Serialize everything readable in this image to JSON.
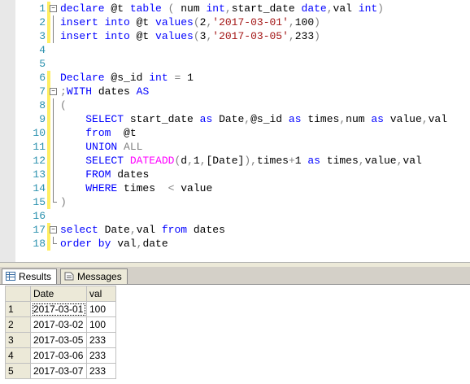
{
  "editor": {
    "lines": [
      {
        "n": "1",
        "segments": [
          [
            "kw",
            "declare "
          ],
          [
            "blk",
            "@t "
          ],
          [
            "kw",
            "table "
          ],
          [
            "gray",
            "( "
          ],
          [
            "blk",
            "num "
          ],
          [
            "kw",
            "int"
          ],
          [
            "gray",
            ","
          ],
          [
            "blk",
            "start_date "
          ],
          [
            "kw",
            "date"
          ],
          [
            "gray",
            ","
          ],
          [
            "blk",
            "val "
          ],
          [
            "kw",
            "int"
          ],
          [
            "gray",
            ")"
          ]
        ]
      },
      {
        "n": "2",
        "segments": [
          [
            "kw",
            "insert into "
          ],
          [
            "blk",
            "@t "
          ],
          [
            "kw",
            "values"
          ],
          [
            "gray",
            "("
          ],
          [
            "blk",
            "2"
          ],
          [
            "gray",
            ","
          ],
          [
            "str",
            "'2017-03-01'"
          ],
          [
            "gray",
            ","
          ],
          [
            "blk",
            "100"
          ],
          [
            "gray",
            ")"
          ]
        ]
      },
      {
        "n": "3",
        "segments": [
          [
            "kw",
            "insert into "
          ],
          [
            "blk",
            "@t "
          ],
          [
            "kw",
            "values"
          ],
          [
            "gray",
            "("
          ],
          [
            "blk",
            "3"
          ],
          [
            "gray",
            ","
          ],
          [
            "str",
            "'2017-03-05'"
          ],
          [
            "gray",
            ","
          ],
          [
            "blk",
            "233"
          ],
          [
            "gray",
            ")"
          ]
        ]
      },
      {
        "n": "4",
        "segments": []
      },
      {
        "n": "5",
        "segments": []
      },
      {
        "n": "6",
        "segments": [
          [
            "kw",
            "Declare "
          ],
          [
            "blk",
            "@s_id "
          ],
          [
            "kw",
            "int "
          ],
          [
            "gray",
            "= "
          ],
          [
            "blk",
            "1"
          ]
        ]
      },
      {
        "n": "7",
        "segments": [
          [
            "gray",
            ";"
          ],
          [
            "kw",
            "WITH "
          ],
          [
            "blk",
            "dates "
          ],
          [
            "kw",
            "AS"
          ]
        ]
      },
      {
        "n": "8",
        "segments": [
          [
            "gray",
            "("
          ]
        ]
      },
      {
        "n": "9",
        "segments": [
          [
            "blk",
            "    "
          ],
          [
            "kw",
            "SELECT "
          ],
          [
            "blk",
            "start_date "
          ],
          [
            "kw",
            "as "
          ],
          [
            "blk",
            "Date"
          ],
          [
            "gray",
            ","
          ],
          [
            "blk",
            "@s_id "
          ],
          [
            "kw",
            "as "
          ],
          [
            "blk",
            "times"
          ],
          [
            "gray",
            ","
          ],
          [
            "blk",
            "num "
          ],
          [
            "kw",
            "as "
          ],
          [
            "blk",
            "value"
          ],
          [
            "gray",
            ","
          ],
          [
            "blk",
            "val"
          ]
        ]
      },
      {
        "n": "10",
        "segments": [
          [
            "blk",
            "    "
          ],
          [
            "kw",
            "from  "
          ],
          [
            "blk",
            "@t"
          ]
        ]
      },
      {
        "n": "11",
        "segments": [
          [
            "blk",
            "    "
          ],
          [
            "kw",
            "UNION "
          ],
          [
            "gray",
            "ALL"
          ]
        ]
      },
      {
        "n": "12",
        "segments": [
          [
            "blk",
            "    "
          ],
          [
            "kw",
            "SELECT "
          ],
          [
            "fn",
            "DATEADD"
          ],
          [
            "gray",
            "("
          ],
          [
            "blk",
            "d"
          ],
          [
            "gray",
            ","
          ],
          [
            "blk",
            "1"
          ],
          [
            "gray",
            ","
          ],
          [
            "blk",
            "[Date]"
          ],
          [
            "gray",
            "),"
          ],
          [
            "blk",
            "times"
          ],
          [
            "gray",
            "+"
          ],
          [
            "blk",
            "1 "
          ],
          [
            "kw",
            "as "
          ],
          [
            "blk",
            "times"
          ],
          [
            "gray",
            ","
          ],
          [
            "blk",
            "value"
          ],
          [
            "gray",
            ","
          ],
          [
            "blk",
            "val"
          ]
        ]
      },
      {
        "n": "13",
        "segments": [
          [
            "blk",
            "    "
          ],
          [
            "kw",
            "FROM "
          ],
          [
            "blk",
            "dates"
          ]
        ]
      },
      {
        "n": "14",
        "segments": [
          [
            "blk",
            "    "
          ],
          [
            "kw",
            "WHERE "
          ],
          [
            "blk",
            "times  "
          ],
          [
            "gray",
            "< "
          ],
          [
            "blk",
            "value"
          ]
        ]
      },
      {
        "n": "15",
        "segments": [
          [
            "gray",
            ")"
          ]
        ]
      },
      {
        "n": "16",
        "segments": []
      },
      {
        "n": "17",
        "segments": [
          [
            "kw",
            "select "
          ],
          [
            "blk",
            "Date"
          ],
          [
            "gray",
            ","
          ],
          [
            "blk",
            "val "
          ],
          [
            "kw",
            "from "
          ],
          [
            "blk",
            "dates"
          ]
        ]
      },
      {
        "n": "18",
        "segments": [
          [
            "kw",
            "order by "
          ],
          [
            "blk",
            "val"
          ],
          [
            "gray",
            ","
          ],
          [
            "blk",
            "date"
          ]
        ]
      }
    ]
  },
  "tabs": {
    "results_label": "Results",
    "messages_label": "Messages"
  },
  "grid": {
    "columns": [
      "Date",
      "val"
    ],
    "rows": [
      {
        "num": "1",
        "date": "2017-03-01",
        "val": "100"
      },
      {
        "num": "2",
        "date": "2017-03-02",
        "val": "100"
      },
      {
        "num": "3",
        "date": "2017-03-05",
        "val": "233"
      },
      {
        "num": "4",
        "date": "2017-03-06",
        "val": "233"
      },
      {
        "num": "5",
        "date": "2017-03-07",
        "val": "233"
      }
    ]
  },
  "colors": {
    "keyword": "#0000ff",
    "string": "#a31515",
    "function": "#ff00ff",
    "operator": "#808080",
    "line_number": "#2b91af"
  }
}
